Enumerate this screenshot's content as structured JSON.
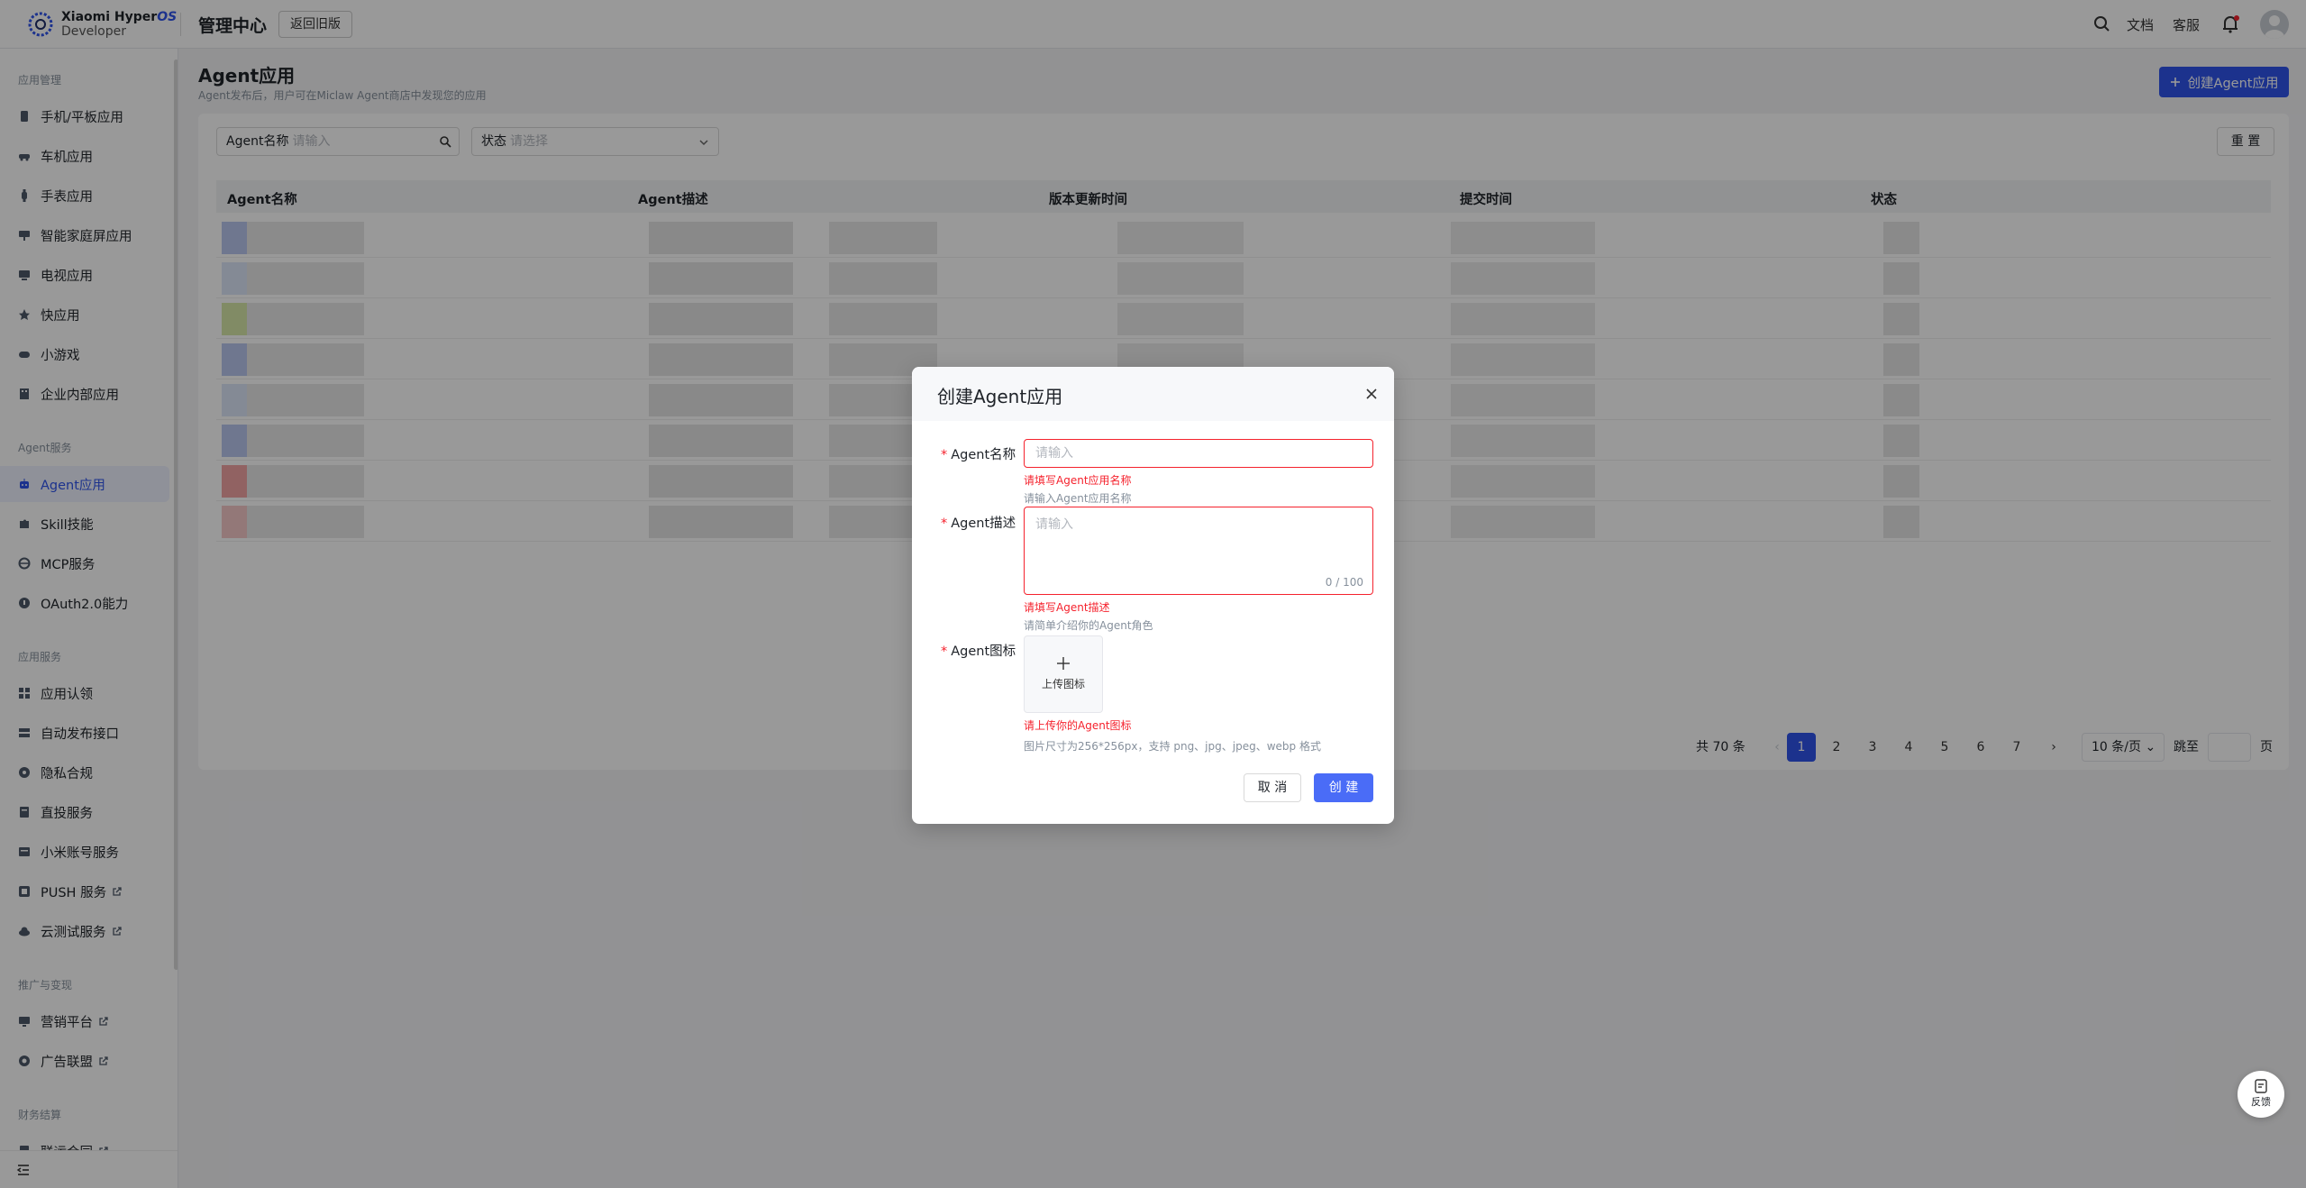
{
  "header": {
    "brand_line1": "Xiaomi Hyper",
    "brand_os": "OS",
    "brand_line2": "Developer",
    "title": "管理中心",
    "old_version_button": "返回旧版",
    "docs_link": "文档",
    "support_link": "客服"
  },
  "sidebar": {
    "groups": [
      {
        "label": "应用管理",
        "items": [
          "手机/平板应用",
          "车机应用",
          "手表应用",
          "智能家庭屏应用",
          "电视应用",
          "快应用",
          "小游戏",
          "企业内部应用"
        ]
      },
      {
        "label": "Agent服务",
        "items": [
          "Agent应用",
          "Skill技能",
          "MCP服务",
          "OAuth2.0能力"
        ]
      },
      {
        "label": "应用服务",
        "items": [
          "应用认领",
          "自动发布接口",
          "隐私合规",
          "直投服务",
          "小米账号服务",
          "PUSH 服务",
          "云测试服务"
        ]
      },
      {
        "label": "推广与变现",
        "items": [
          "营销平台",
          "广告联盟"
        ]
      },
      {
        "label": "财务结算",
        "items": [
          "联运合同"
        ]
      }
    ],
    "active_item": "Agent应用"
  },
  "page": {
    "title": "Agent应用",
    "subtitle": "Agent发布后，用户可在Miclaw Agent商店中发现您的应用",
    "create_button": "创建Agent应用",
    "filter_name_label": "Agent名称",
    "filter_name_placeholder": "请输入",
    "filter_status_label": "状态",
    "filter_status_placeholder": "请选择",
    "reset_button": "重 置",
    "columns": [
      "Agent名称",
      "Agent描述",
      "版本更新时间",
      "提交时间",
      "状态"
    ]
  },
  "pagination": {
    "total": "共 70 条",
    "pages": [
      "1",
      "2",
      "3",
      "4",
      "5",
      "6",
      "7"
    ],
    "current": "1",
    "page_size": "10 条/页",
    "jump_label": "跳至",
    "page_unit": "页"
  },
  "modal": {
    "title": "创建Agent应用",
    "name_label": "Agent名称",
    "name_placeholder": "请输入",
    "name_error": "请填写Agent应用名称",
    "name_hint": "请输入Agent应用名称",
    "desc_label": "Agent描述",
    "desc_placeholder": "请输入",
    "desc_count": "0 / 100",
    "desc_error": "请填写Agent描述",
    "desc_hint": "请简单介绍你的Agent角色",
    "icon_label": "Agent图标",
    "upload_text": "上传图标",
    "icon_error": "请上传你的Agent图标",
    "icon_hint": "图片尺寸为256*256px，支持 png、jpg、jpeg、webp 格式",
    "cancel_button": "取 消",
    "create_button": "创 建"
  },
  "feedback": {
    "label": "反馈"
  },
  "colors": {
    "primary": "#2f54eb",
    "error": "#f5222d",
    "overlay": "rgba(0,0,0,0.40)"
  }
}
